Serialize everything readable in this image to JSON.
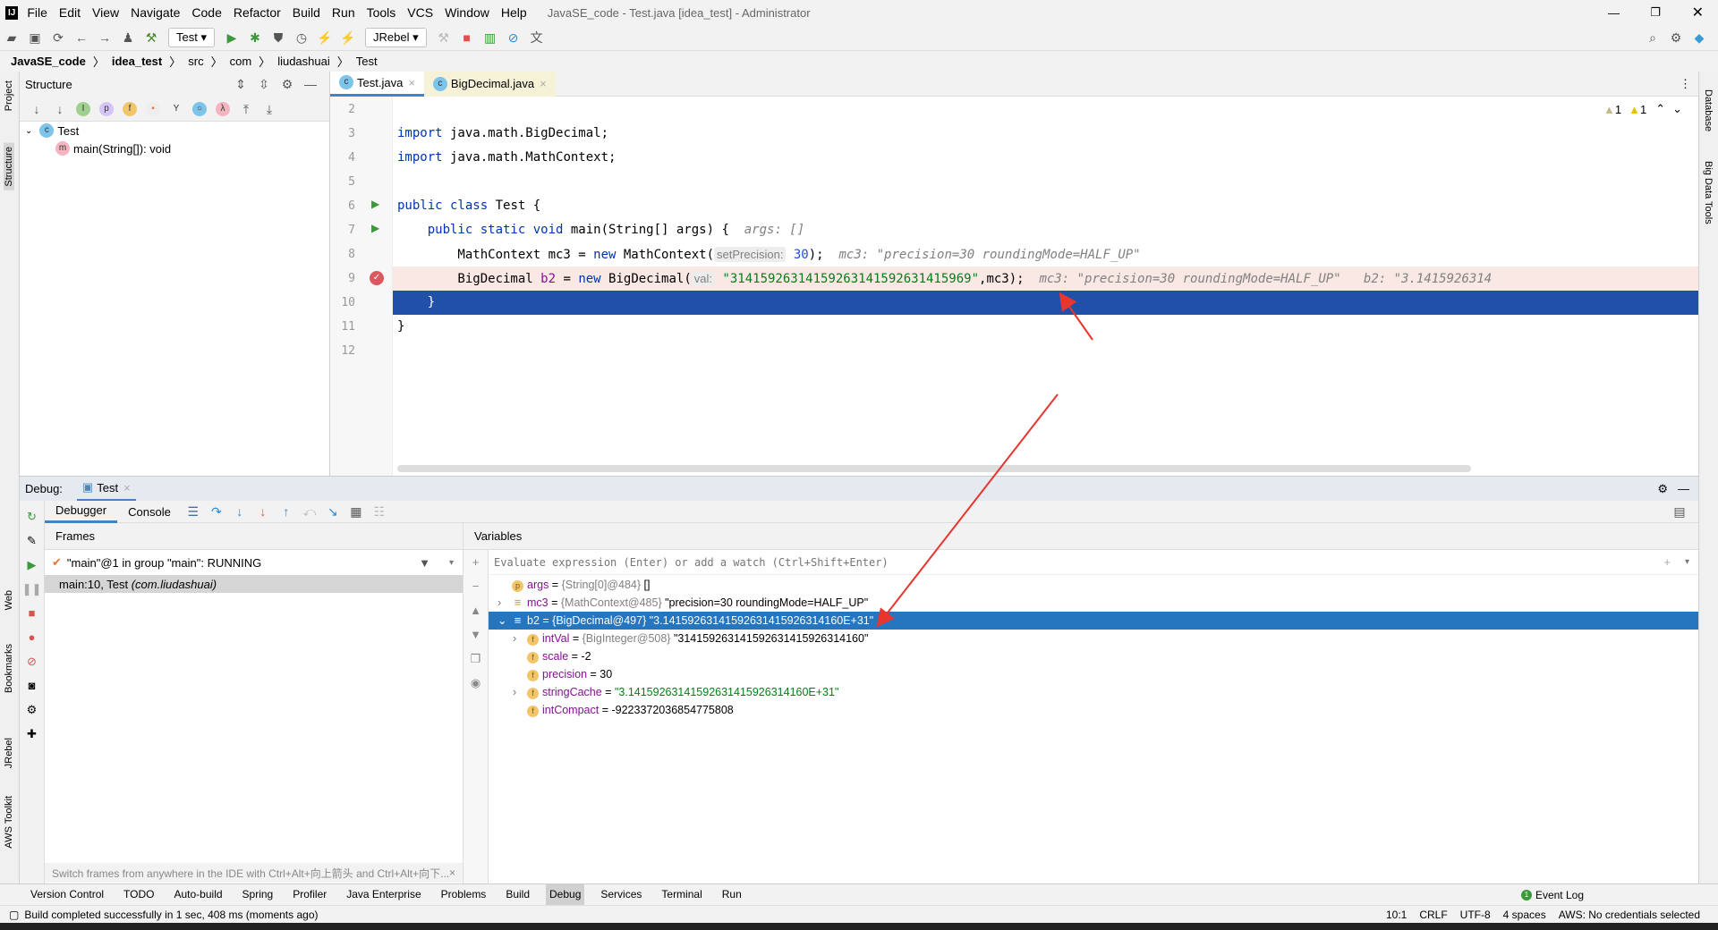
{
  "app": {
    "title": "JavaSE_code - Test.java [idea_test] - Administrator",
    "logo": "IJ"
  },
  "menu": [
    "File",
    "Edit",
    "View",
    "Navigate",
    "Code",
    "Refactor",
    "Build",
    "Run",
    "Tools",
    "VCS",
    "Window",
    "Help"
  ],
  "toolbar": {
    "run_config": "Test",
    "jrebel": "JRebel"
  },
  "breadcrumb": [
    "JavaSE_code",
    "idea_test",
    "src",
    "com",
    "liudashuai",
    "Test"
  ],
  "left_strip": [
    "Project",
    "Structure",
    "Web",
    "Bookmarks",
    "JRebel",
    "AWS Toolkit"
  ],
  "right_strip": [
    "Database",
    "Big Data Tools"
  ],
  "structure": {
    "title": "Structure",
    "tree": [
      {
        "label": "Test"
      },
      {
        "label": "main(String[]): void"
      }
    ]
  },
  "editor": {
    "tabs": [
      {
        "label": "Test.java",
        "active": true
      },
      {
        "label": "BigDecimal.java",
        "active": false
      }
    ],
    "warnings": [
      "1",
      "1"
    ],
    "line_numbers": [
      "2",
      "3",
      "4",
      "5",
      "6",
      "7",
      "8",
      "9",
      "10",
      "11",
      "12"
    ],
    "lines": {
      "l3a": "import",
      "l3b": " java.math.BigDecimal;",
      "l4a": "import",
      "l4b": " java.math.MathContext;",
      "l6a": "public class",
      "l6b": " Test {",
      "l7a": "    public static void",
      "l7b": " main(String[] args) {",
      "l7h": "  args: []",
      "l8a": "        MathContext mc3 = ",
      "l8k": "new",
      "l8b": " MathContext(",
      "l8i": "setPrecision:",
      "l8n": " 30",
      "l8c": ");",
      "l8h": "  mc3: \"precision=30 roundingMode=HALF_UP\"",
      "l9a": "        BigDecimal ",
      "l9v": "b2",
      "l9b": " = ",
      "l9k": "new",
      "l9c": " BigDecimal(",
      "l9i": "val:",
      "l9s": " \"31415926314159263141592631415969\"",
      "l9d": ",mc3);",
      "l9h": "  mc3: \"precision=30 roundingMode=HALF_UP\"   b2: \"3.1415926314",
      "l10": "    }",
      "l11": "}"
    }
  },
  "debug": {
    "label": "Debug:",
    "session": "Test",
    "tabs": [
      "Debugger",
      "Console"
    ],
    "frames_title": "Frames",
    "thread": "\"main\"@1 in group \"main\": RUNNING",
    "frame": "main:10, Test",
    "frame_pkg": "(com.liudashuai)",
    "hint": "Switch frames from anywhere in the IDE with Ctrl+Alt+向上箭头 and Ctrl+Alt+向下...",
    "variables_title": "Variables",
    "eval_placeholder": "Evaluate expression (Enter) or add a watch (Ctrl+Shift+Enter)",
    "vars": [
      {
        "name": "args",
        "type": "{String[0]@484}",
        "value": "[]",
        "icon": "p",
        "expandable": false,
        "depth": 0
      },
      {
        "name": "mc3",
        "type": "{MathContext@485}",
        "value": "\"precision=30 roundingMode=HALF_UP\"",
        "icon": "≡",
        "expandable": true,
        "depth": 0
      },
      {
        "name": "b2",
        "type": "{BigDecimal@497}",
        "value": "\"3.14159263141592631415926314160E+31\"",
        "icon": "≡",
        "expandable": true,
        "expanded": true,
        "selected": true,
        "depth": 0
      },
      {
        "name": "intVal",
        "type": "{BigInteger@508}",
        "value": "\"314159263141592631415926314160\"",
        "icon": "f",
        "expandable": true,
        "depth": 1
      },
      {
        "name": "scale",
        "type": "",
        "value": "-2",
        "icon": "f",
        "expandable": false,
        "depth": 1
      },
      {
        "name": "precision",
        "type": "",
        "value": "30",
        "icon": "f",
        "expandable": false,
        "depth": 1
      },
      {
        "name": "stringCache",
        "type": "",
        "value": "\"3.14159263141592631415926314160E+31\"",
        "icon": "f",
        "expandable": true,
        "depth": 1
      },
      {
        "name": "intCompact",
        "type": "",
        "value": "-9223372036854775808",
        "icon": "f",
        "expandable": false,
        "depth": 1
      }
    ]
  },
  "tool_windows": [
    "Version Control",
    "TODO",
    "Auto-build",
    "Spring",
    "Profiler",
    "Java Enterprise",
    "Problems",
    "Build",
    "Debug",
    "Services",
    "Terminal",
    "Run"
  ],
  "active_tool_window": "Debug",
  "event_log": "Event Log",
  "status": {
    "message": "Build completed successfully in 1 sec, 408 ms (moments ago)",
    "position": "10:1",
    "line_sep": "CRLF",
    "encoding": "UTF-8",
    "indent": "4 spaces",
    "aws": "AWS: No credentials selected"
  },
  "colors": {
    "selection": "#2675bf",
    "current_line": "#2150a8",
    "breakpoint_line": "#fae8e4",
    "annotation_arrow": "#e8352e"
  }
}
